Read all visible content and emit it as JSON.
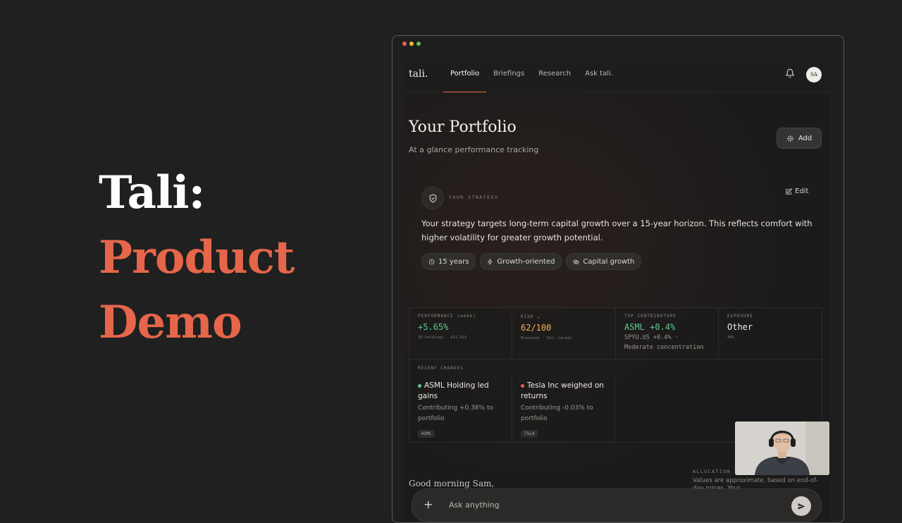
{
  "hero": {
    "line1": "Tali:",
    "line2": "Product",
    "line3": "Demo"
  },
  "window": {
    "dot_colors": [
      "#ed5f56",
      "#f5be3b",
      "#5fc24b"
    ]
  },
  "nav": {
    "logo": "tali.",
    "tabs": [
      {
        "label": "Portfolio",
        "active": true
      },
      {
        "label": "Briefings"
      },
      {
        "label": "Research"
      },
      {
        "label": "Ask tali."
      }
    ],
    "avatar_initials": "SA"
  },
  "page": {
    "title": "Your Portfolio",
    "subtitle": "At a glance performance tracking",
    "add_label": "Add"
  },
  "strategy": {
    "label": "YOUR STRATEGY",
    "edit_label": "Edit",
    "text": "Your strategy targets long-term capital growth over a 15-year horizon. This reflects comfort with higher volatility for greater growth potential.",
    "chips": [
      "15 years",
      "Growth-oriented",
      "Capital growth"
    ]
  },
  "metrics": {
    "performance": {
      "label": "PERFORMANCE (week)",
      "value": "+5.65%",
      "sub": "10 holdings · £11,821",
      "color": "#5fc88f"
    },
    "risk": {
      "label": "RISK",
      "value": "62/100",
      "sub": "Elevated · Vol: normal",
      "color": "#f0b257"
    },
    "top_contributors": {
      "label": "TOP CONTRIBUTORS",
      "value": "ASML +0.4%",
      "sub1": "SPYU.US +0.4% ·",
      "sub2": "Moderate concentration",
      "color": "#5fc88f"
    },
    "exposure": {
      "label": "EXPOSURE",
      "value": "Other",
      "sub": "40%"
    }
  },
  "recent_changes": {
    "label": "RECENT CHANGES",
    "items": [
      {
        "title": "ASML Holding led gains",
        "sub": "Contributing +0.38% to portfolio",
        "ticker": "ASML",
        "dot": "#5fc88f"
      },
      {
        "title": "Tesla Inc weighed on returns",
        "sub": "Contributing -0.03% to portfolio",
        "ticker": "TSLA",
        "dot": "#e5664a"
      }
    ]
  },
  "bottom": {
    "greeting": "Good morning Sam,",
    "allocation_label": "ALLOCATION",
    "allocation_note": "Values are approximate, based on end-of-day prices. Your",
    "ask_placeholder": "Ask anything"
  }
}
